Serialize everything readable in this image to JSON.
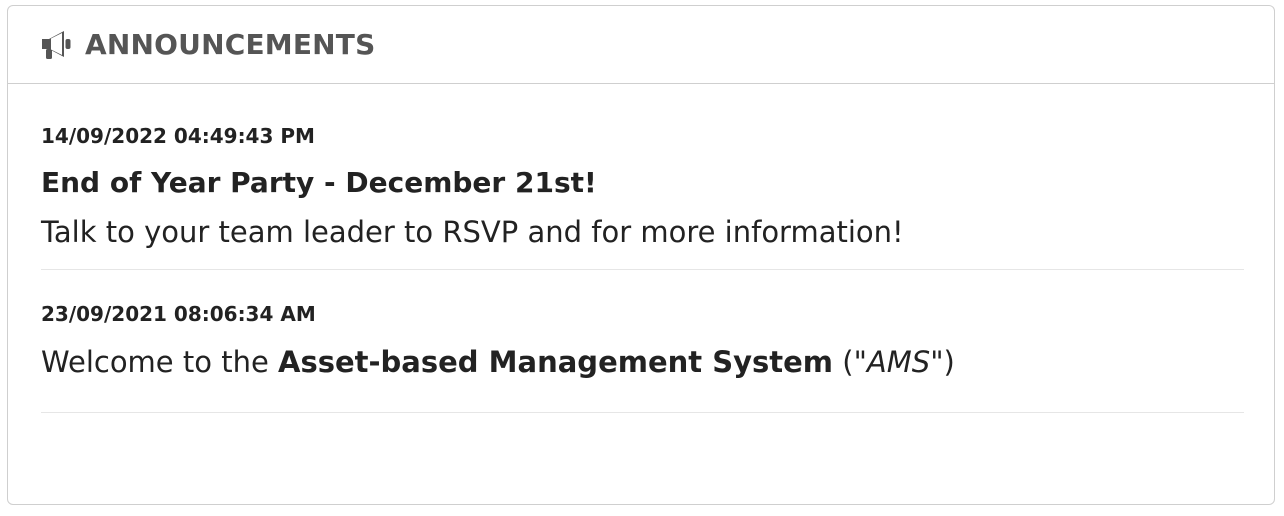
{
  "panel": {
    "title": "ANNOUNCEMENTS",
    "icon": "megaphone-icon"
  },
  "announcements": [
    {
      "date": "14/09/2022 04:49:43 PM",
      "title": "End of Year Party - December 21st!",
      "text": "Talk to your team leader to RSVP and for more information!"
    },
    {
      "date": "23/09/2021 08:06:34 AM",
      "text_prefix": "Welcome to the ",
      "text_bold": "Asset-based Management System",
      "text_open": " (\"",
      "text_italic": "AMS",
      "text_close": "\")"
    }
  ],
  "colors": {
    "header_text": "#555555",
    "body_text": "#222222",
    "border": "#cfcfcf",
    "divider": "#e6e6e6"
  }
}
